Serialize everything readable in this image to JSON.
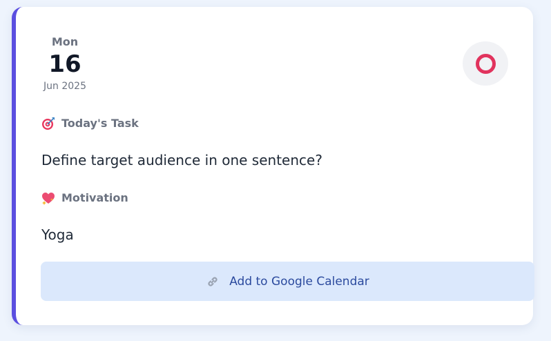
{
  "date": {
    "day_of_week": "Mon",
    "day": "16",
    "month_year": "Jun 2025"
  },
  "status": {
    "icon": "circle-icon",
    "color": "#e1335d"
  },
  "task": {
    "label": "Today's Task",
    "icon": "target-icon",
    "text": "Define target audience in one sentence?"
  },
  "motivation": {
    "label": "Motivation",
    "icon": "sparkling-heart-icon",
    "text": "Yoga"
  },
  "calendar_button": {
    "label": "Add to Google Calendar",
    "icon": "link-icon"
  },
  "colors": {
    "accent": "#5b4fe0",
    "button_bg": "#dbe8fc",
    "button_text": "#2b4a9e"
  }
}
